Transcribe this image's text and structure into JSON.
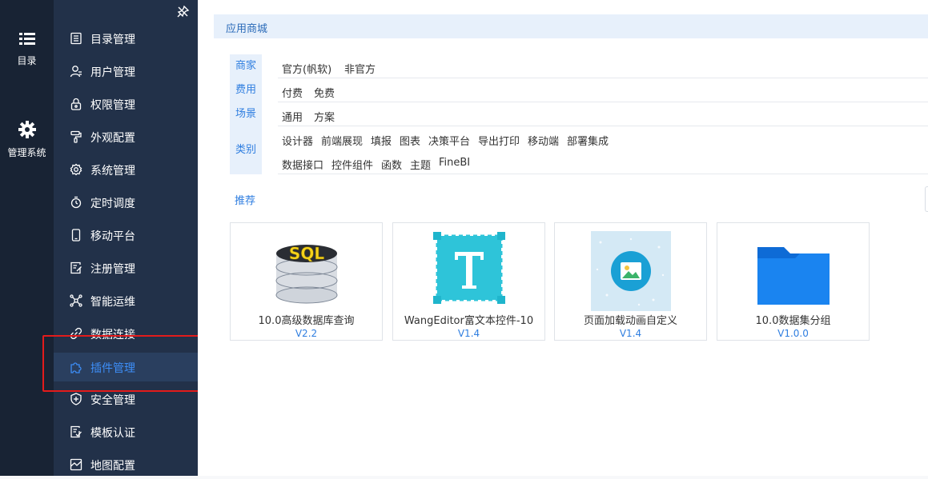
{
  "rail": [
    {
      "icon": "list-icon",
      "label": "目录"
    },
    {
      "icon": "gear-icon",
      "label": "管理系统"
    }
  ],
  "nav": [
    {
      "icon": "catalog-icon",
      "label": "目录管理"
    },
    {
      "icon": "user-icon",
      "label": "用户管理"
    },
    {
      "icon": "lock-icon",
      "label": "权限管理"
    },
    {
      "icon": "paint-roller-icon",
      "label": "外观配置"
    },
    {
      "icon": "settings-icon",
      "label": "系统管理"
    },
    {
      "icon": "timer-icon",
      "label": "定时调度"
    },
    {
      "icon": "mobile-icon",
      "label": "移动平台"
    },
    {
      "icon": "register-icon",
      "label": "注册管理"
    },
    {
      "icon": "ops-icon",
      "label": "智能运维"
    },
    {
      "icon": "link-icon",
      "label": "数据连接"
    },
    {
      "icon": "puzzle-icon",
      "label": "插件管理",
      "active": true
    },
    {
      "icon": "shield-icon",
      "label": "安全管理"
    },
    {
      "icon": "template-icon",
      "label": "模板认证"
    },
    {
      "icon": "map-icon",
      "label": "地图配置"
    }
  ],
  "main": {
    "header": "应用商城",
    "filters": {
      "vendor": {
        "label": "商家",
        "options": [
          "官方(帆软)",
          "非官方"
        ]
      },
      "fee": {
        "label": "费用",
        "options": [
          "付费",
          "免费"
        ]
      },
      "scene": {
        "label": "场景",
        "options": [
          "通用",
          "方案"
        ]
      },
      "category": {
        "label": "类别",
        "options": [
          "设计器",
          "前端展现",
          "填报",
          "图表",
          "决策平台",
          "导出打印",
          "移动端",
          "部署集成",
          "数据接口",
          "控件组件",
          "函数",
          "主题",
          "FineBI"
        ]
      }
    },
    "recommend": "推荐",
    "cards": [
      {
        "title": "10.0高级数据库查询",
        "version": "V2.2",
        "icon": "sql-database-icon"
      },
      {
        "title": "WangEditor富文本控件-10",
        "version": "V1.4",
        "icon": "text-editor-icon"
      },
      {
        "title": "页面加载动画自定义",
        "version": "V1.4",
        "icon": "image-loading-icon"
      },
      {
        "title": "10.0数据集分组",
        "version": "V1.0.0",
        "icon": "folder-icon"
      }
    ]
  },
  "colors": {
    "rail_bg": "#182334",
    "nav_bg": "#223149",
    "active": "#3d8ef7",
    "highlight": "#e31b1b",
    "link": "#2f7ee0"
  }
}
